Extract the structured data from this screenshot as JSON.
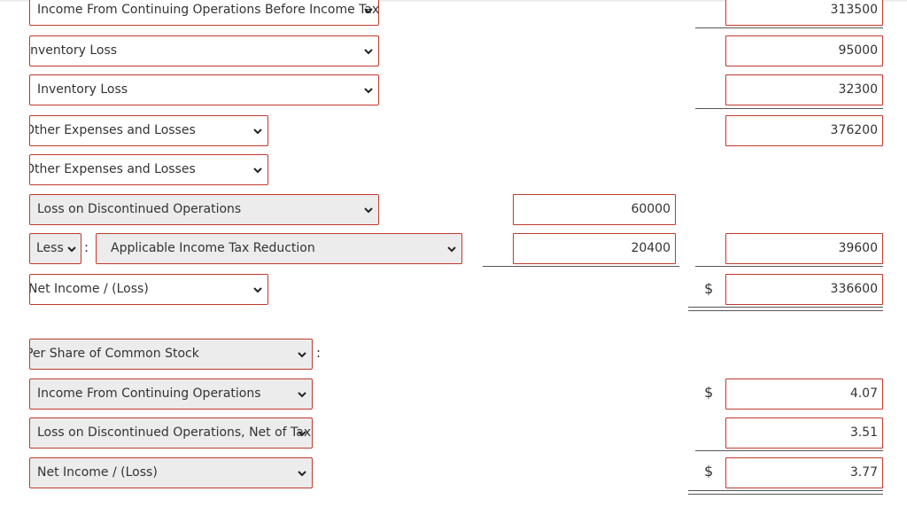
{
  "rows": [
    {
      "label": "Income From Continuing Operations Before Income Tax",
      "col2": "313500"
    },
    {
      "label": "Inventory Loss",
      "col2": "95000"
    },
    {
      "label": "Inventory Loss",
      "col2": "32300"
    },
    {
      "label": "Other Expenses and Losses",
      "col2": "376200"
    },
    {
      "label": "Other Expenses and Losses"
    },
    {
      "label": "Loss on Discontinued Operations",
      "col1": "60000"
    },
    {
      "prefix": "Less",
      "label": "Applicable Income Tax Reduction",
      "col1": "20400",
      "col2": "39600"
    },
    {
      "label": "Net Income / (Loss)",
      "col2": "336600",
      "currency": "$"
    },
    {
      "label": "Per Share of Common Stock",
      "suffix": ":"
    },
    {
      "label": "Income From Continuing Operations",
      "col2": "4.07",
      "currency": "$"
    },
    {
      "label": "Loss on Discontinued Operations, Net of Tax",
      "col2": "3.51"
    },
    {
      "label": "Net Income / (Loss)",
      "col2": "3.77",
      "currency": "$"
    }
  ],
  "separator": ":",
  "icons": {
    "dropdown": "chevron-down-icon"
  }
}
